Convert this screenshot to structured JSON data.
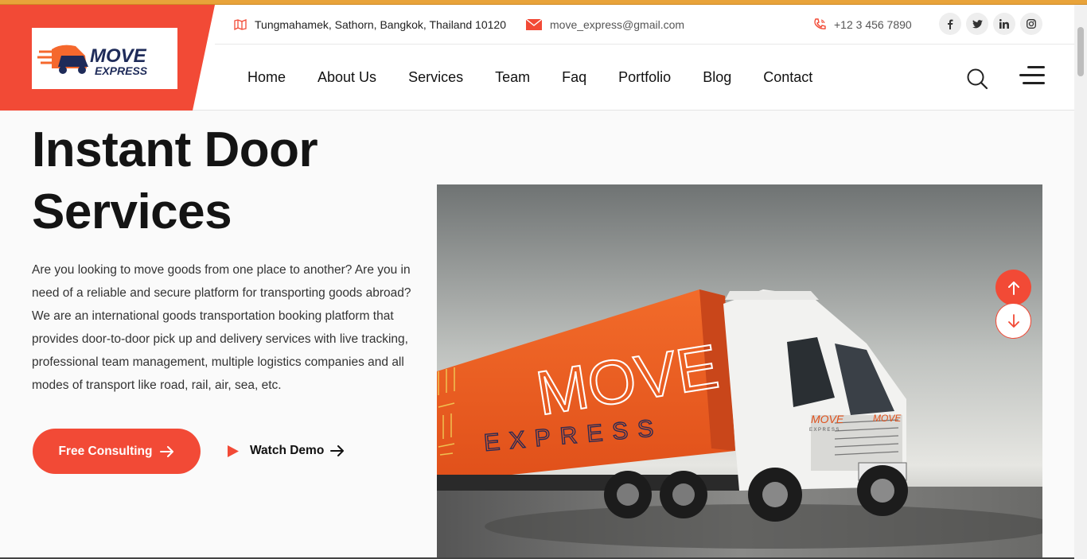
{
  "brand": {
    "logo_word_top": "MOVE",
    "logo_word_bottom": "EXPRESS",
    "accent": "#f24a36",
    "dark": "#1e2b59"
  },
  "topbar": {
    "address": "Tungmahamek, Sathorn, Bangkok, Thailand 10120",
    "email": "move_express@gmail.com",
    "phone": "+12 3 456 7890",
    "socials": [
      {
        "icon": "facebook-icon",
        "glyph": "f"
      },
      {
        "icon": "twitter-icon",
        "glyph": "t"
      },
      {
        "icon": "linkedin-icon",
        "glyph": "in"
      },
      {
        "icon": "instagram-icon",
        "glyph": "ig"
      }
    ]
  },
  "nav": {
    "items": [
      "Home",
      "About Us",
      "Services",
      "Team",
      "Faq",
      "Portfolio",
      "Blog",
      "Contact"
    ]
  },
  "hero": {
    "title_line1": "Instant Door",
    "title_line2": "Services",
    "description": "Are you looking to move goods from one place to another? Are you in need of a reliable and secure platform for transporting goods abroad? We are an international goods transportation booking platform that provides door-to-door pick up and delivery services with live tracking, professional team management, multiple logistics companies and all modes of transport like road, rail, air, sea, etc.",
    "primary_button": "Free Consulting",
    "secondary_button": "Watch Demo"
  },
  "truck": {
    "trailer_brand": "MOVE",
    "trailer_sub": "EXPRESS",
    "cab_brand": "MOVE",
    "cab_sub": "EXPRESS"
  }
}
